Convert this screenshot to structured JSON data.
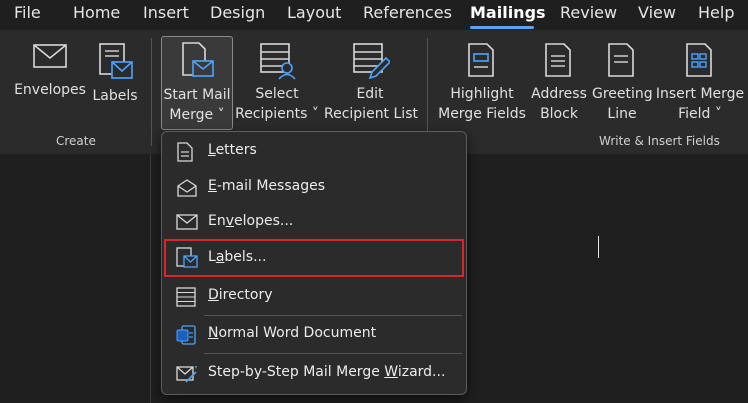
{
  "menubar": {
    "tabs": [
      "File",
      "Home",
      "Insert",
      "Design",
      "Layout",
      "References",
      "Mailings",
      "Review",
      "View",
      "Help"
    ],
    "active": "Mailings"
  },
  "ribbon": {
    "create": {
      "group_label": "Create",
      "envelopes": "Envelopes",
      "labels": "Labels"
    },
    "start": {
      "start_mail_merge": [
        "Start Mail",
        "Merge ˅"
      ],
      "select_recipients": [
        "Select",
        "Recipients ˅"
      ],
      "edit_recipient_list": [
        "Edit",
        "Recipient List"
      ]
    },
    "write": {
      "group_label": "Write & Insert Fields",
      "highlight": [
        "Highlight",
        "Merge Fields"
      ],
      "address_block": [
        "Address",
        "Block"
      ],
      "greeting_line": [
        "Greeting",
        "Line"
      ],
      "insert_merge_field": [
        "Insert Merge",
        "Field ˅"
      ]
    }
  },
  "dropdown": {
    "items": [
      {
        "pre": "",
        "ul": "L",
        "post": "etters",
        "icon": "document-icon"
      },
      {
        "pre": "",
        "ul": "E",
        "post": "-mail Messages",
        "icon": "open-envelope-icon"
      },
      {
        "pre": "En",
        "ul": "v",
        "post": "elopes...",
        "icon": "envelope-icon"
      },
      {
        "pre": "L",
        "ul": "a",
        "post": "bels...",
        "icon": "labels-icon"
      },
      {
        "pre": "",
        "ul": "D",
        "post": "irectory",
        "icon": "directory-icon"
      },
      {
        "pre": "",
        "ul": "N",
        "post": "ormal Word Document",
        "icon": "word-document-icon"
      },
      {
        "pre": "Step-by-Step Mail Merge ",
        "ul": "W",
        "post": "izard...",
        "icon": "wizard-icon"
      }
    ],
    "selected_index": 3
  },
  "colors": {
    "accent": "#5aa0f5",
    "highlight_border": "#d9262b",
    "background": "#1f1f1f",
    "ribbon": "#2b2b2b"
  }
}
